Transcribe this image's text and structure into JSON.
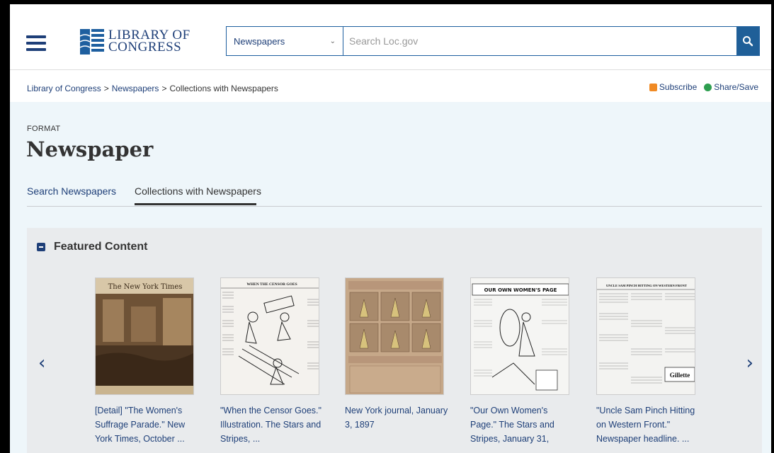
{
  "header": {
    "logo_line1": "LIBRARY OF",
    "logo_line2": "CONGRESS",
    "search_scope": "Newspapers",
    "search_placeholder": "Search Loc.gov"
  },
  "breadcrumb": {
    "items": [
      "Library of Congress",
      "Newspapers",
      "Collections with Newspapers"
    ],
    "separator": ">"
  },
  "tools": {
    "subscribe": "Subscribe",
    "share": "Share/Save"
  },
  "page": {
    "format_label": "FORMAT",
    "title": "Newspaper",
    "tabs": [
      {
        "label": "Search Newspapers",
        "active": false
      },
      {
        "label": "Collections with Newspapers",
        "active": true
      }
    ]
  },
  "featured": {
    "title": "Featured Content",
    "items": [
      {
        "caption_lines": [
          "[Detail] \"The Women's",
          "Suffrage Parade.\" New",
          "York Times, October ..."
        ]
      },
      {
        "caption_lines": [
          "\"When the Censor Goes.\"",
          "Illustration. The Stars and",
          "Stripes, ..."
        ]
      },
      {
        "caption_lines": [
          "New York journal, January",
          "3, 1897"
        ]
      },
      {
        "caption_lines": [
          "\"Our Own Women's",
          "Page.\" The Stars and",
          "Stripes, January 31,"
        ]
      },
      {
        "caption_lines": [
          "\"Uncle Sam Pinch Hitting",
          "on Western Front.\"",
          "Newspaper headline. ..."
        ]
      }
    ],
    "thumb_text": {
      "nyt_masthead": "The New York Times",
      "censor_headline": "WHEN THE CENSOR GOES",
      "women_page_headline": "OUR OWN WOMEN'S PAGE",
      "uncle_sam_headline": "UNCLE SAM PINCH HITTING ON WESTERN FRONT",
      "gillette_ad": "Gillette"
    }
  },
  "colors": {
    "brand_blue": "#1e3f78",
    "hero_bg": "#eef6fa",
    "featured_bg": "#e9ebed",
    "search_button": "#1f5f98"
  },
  "icons": [
    "menu-icon",
    "logo-icon",
    "chevron-down-icon",
    "search-icon",
    "rss-icon",
    "share-icon",
    "collapse-icon",
    "chevron-left-icon",
    "chevron-right-icon"
  ]
}
